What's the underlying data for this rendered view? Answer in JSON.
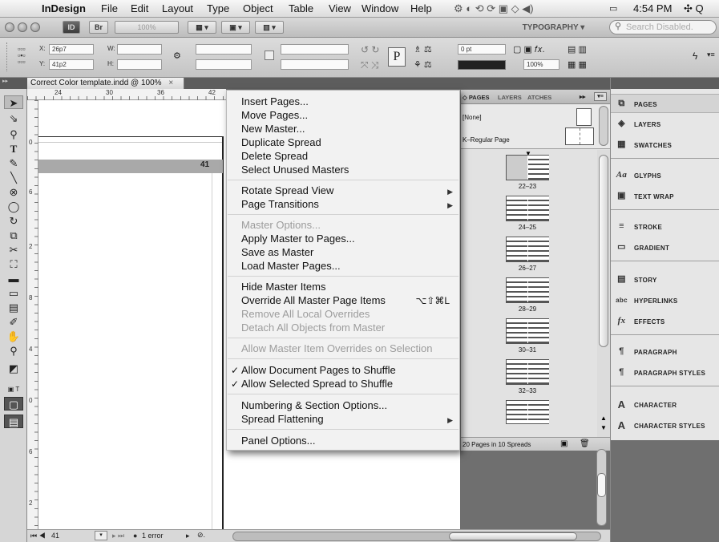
{
  "menubar": {
    "apple": "",
    "app": "InDesign",
    "items": [
      "File",
      "Edit",
      "Layout",
      "Type",
      "Object",
      "Table",
      "View",
      "Window",
      "Help"
    ],
    "clock": "4:54 PM"
  },
  "appbar": {
    "chip_id": "ID",
    "chip_br": "Br",
    "zoom": "100%",
    "workspace": "TYPOGRAPHY ▾",
    "search_placeholder": "Search Disabled."
  },
  "control": {
    "x_label": "X:",
    "x_value": "26p7",
    "y_label": "Y:",
    "y_value": "41p2",
    "w_label": "W:",
    "h_label": "H:",
    "stroke_weight": "0 pt",
    "scale": "100%"
  },
  "document": {
    "tab_title": "Correct Color template.indd @ 100%",
    "page_number": "41",
    "ruler_h": [
      "24",
      "30",
      "36",
      "42"
    ],
    "ruler_v": [
      "0",
      "6",
      "2",
      "8",
      "4",
      "0",
      "6",
      "2"
    ]
  },
  "status": {
    "page_field": "41",
    "errors": "1 error"
  },
  "context_menu": {
    "items": [
      {
        "label": "Insert Pages...",
        "disabled": false
      },
      {
        "label": "Move Pages...",
        "disabled": false
      },
      {
        "label": "New Master...",
        "disabled": false
      },
      {
        "label": "Duplicate Spread",
        "disabled": false
      },
      {
        "label": "Delete Spread",
        "disabled": false
      },
      {
        "label": "Select Unused Masters",
        "disabled": false
      },
      {
        "label": "Rotate Spread View",
        "disabled": false,
        "submenu": true
      },
      {
        "label": "Page Transitions",
        "disabled": false,
        "submenu": true
      },
      {
        "label": "Master Options...",
        "disabled": true
      },
      {
        "label": "Apply Master to Pages...",
        "disabled": false
      },
      {
        "label": "Save as Master",
        "disabled": false
      },
      {
        "label": "Load Master Pages...",
        "disabled": false
      },
      {
        "label": "Hide Master Items",
        "disabled": false
      },
      {
        "label": "Override All Master Page Items",
        "disabled": false,
        "shortcut": "⌥⇧⌘L"
      },
      {
        "label": "Remove All Local Overrides",
        "disabled": true
      },
      {
        "label": "Detach All Objects from Master",
        "disabled": true
      },
      {
        "label": "Allow Master Item Overrides on Selection",
        "disabled": true
      },
      {
        "label": "Allow Document Pages to Shuffle",
        "disabled": false,
        "checked": true
      },
      {
        "label": "Allow Selected Spread to Shuffle",
        "disabled": false,
        "checked": true
      },
      {
        "label": "Numbering & Section Options...",
        "disabled": false
      },
      {
        "label": "Spread Flattening",
        "disabled": false,
        "submenu": true
      },
      {
        "label": "Panel Options...",
        "disabled": false
      }
    ]
  },
  "pages_panel": {
    "tabs": [
      "◇ PAGES",
      "LAYERS",
      "ATCHES"
    ],
    "master_none": "[None]",
    "master_k": "K–Regular Page",
    "spreads": [
      "22–23",
      "24–25",
      "26–27",
      "28–29",
      "30–31",
      "32–33"
    ],
    "footer": "20 Pages in 10 Spreads"
  },
  "side_panel": {
    "items": [
      {
        "label": "PAGES",
        "icon": "pages-icon"
      },
      {
        "label": "LAYERS",
        "icon": "layers-icon"
      },
      {
        "label": "SWATCHES",
        "icon": "swatches-icon"
      },
      {
        "label": "GLYPHS",
        "icon": "glyphs-icon"
      },
      {
        "label": "TEXT WRAP",
        "icon": "text-wrap-icon"
      },
      {
        "label": "STROKE",
        "icon": "stroke-icon"
      },
      {
        "label": "GRADIENT",
        "icon": "gradient-icon"
      },
      {
        "label": "STORY",
        "icon": "story-icon"
      },
      {
        "label": "HYPERLINKS",
        "icon": "hyperlinks-icon"
      },
      {
        "label": "EFFECTS",
        "icon": "effects-icon"
      },
      {
        "label": "PARAGRAPH",
        "icon": "paragraph-icon"
      },
      {
        "label": "PARAGRAPH STYLES",
        "icon": "paragraph-styles-icon"
      },
      {
        "label": "CHARACTER",
        "icon": "character-icon"
      },
      {
        "label": "CHARACTER STYLES",
        "icon": "character-styles-icon"
      }
    ]
  }
}
